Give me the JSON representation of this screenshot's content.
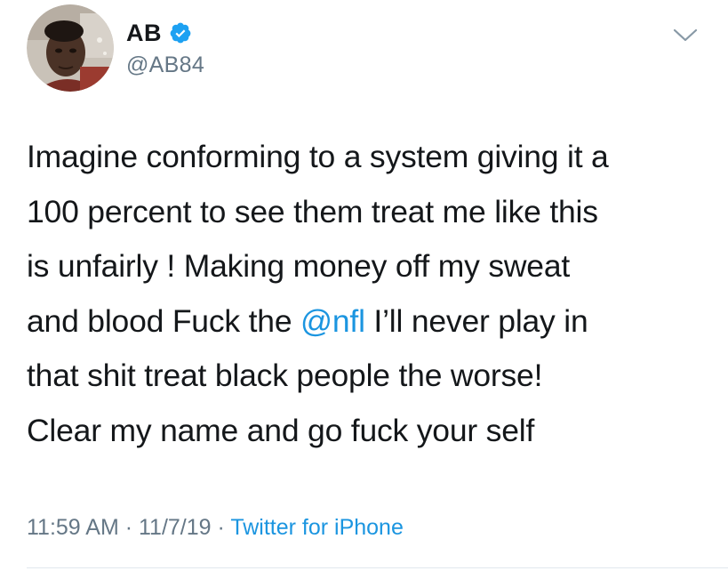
{
  "tweet": {
    "author": {
      "display_name": "AB",
      "handle": "@AB84",
      "verified": true,
      "verified_icon": "verified-badge-icon",
      "avatar_icon": "profile-photo"
    },
    "text_lines": [
      {
        "segments": [
          {
            "text": "Imagine conforming to a system giving it a"
          }
        ]
      },
      {
        "segments": [
          {
            "text": "100 percent to see them treat me like this"
          }
        ]
      },
      {
        "segments": [
          {
            "text": "is unfairly ! Making money off my sweat"
          }
        ]
      },
      {
        "segments": [
          {
            "text": "and blood Fuck the "
          },
          {
            "text": "@nfl",
            "mention": true
          },
          {
            "text": " I’ll never play in"
          }
        ]
      },
      {
        "segments": [
          {
            "text": "that shit treat black people the worse!"
          }
        ]
      },
      {
        "segments": [
          {
            "text": "Clear my name and go fuck your self"
          }
        ]
      }
    ],
    "meta": {
      "time": "11:59 AM",
      "date": "11/7/19",
      "separator": " · ",
      "source": "Twitter for iPhone"
    },
    "menu_icon": "chevron-down-icon"
  },
  "colors": {
    "text": "#14171a",
    "secondary": "#657786",
    "link": "#1b95e0",
    "verified": "#1da1f2",
    "divider": "#e1e8ed"
  }
}
